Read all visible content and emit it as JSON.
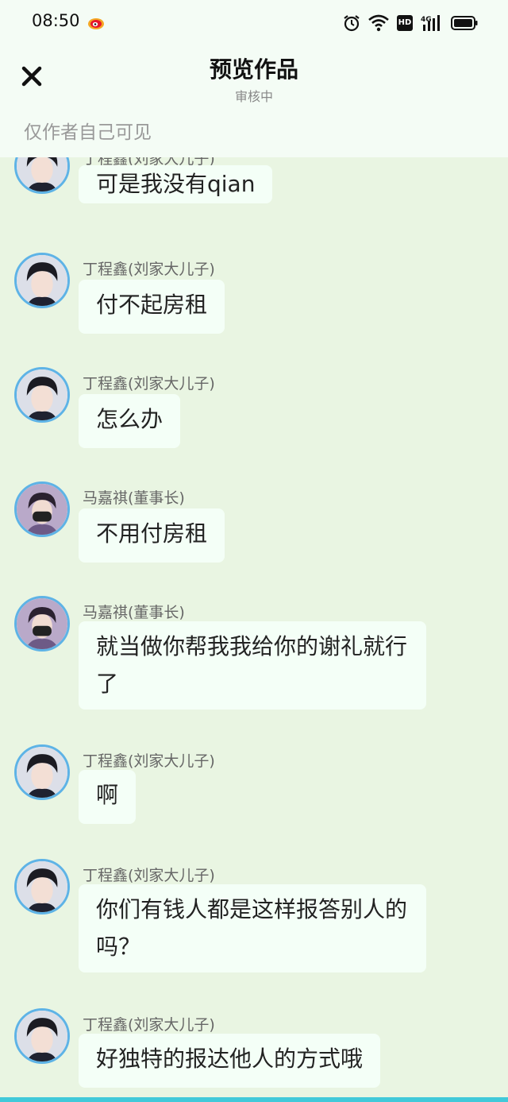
{
  "status_bar": {
    "time": "08:50",
    "network": "4G"
  },
  "header": {
    "title": "预览作品",
    "subtitle": "审核中",
    "notice": "仅作者自己可见"
  },
  "messages": [
    {
      "sender": "丁程鑫(刘家大儿子)",
      "text": "可是我没有qian"
    },
    {
      "sender": "丁程鑫(刘家大儿子)",
      "text": "付不起房租"
    },
    {
      "sender": "丁程鑫(刘家大儿子)",
      "text": "怎么办"
    },
    {
      "sender": "马嘉祺(董事长)",
      "text": "不用付房租"
    },
    {
      "sender": "马嘉祺(董事长)",
      "text": "就当做你帮我我给你的谢礼就行了"
    },
    {
      "sender": "丁程鑫(刘家大儿子)",
      "text": "啊"
    },
    {
      "sender": "丁程鑫(刘家大儿子)",
      "text": "你们有钱人都是这样报答别人的吗？"
    },
    {
      "sender": "丁程鑫(刘家大儿子)",
      "text": "好独特的报达他人的方式哦"
    }
  ],
  "colors": {
    "accent_ring": "#5eb3e6",
    "background": "#e9f5e2",
    "bubble": "#f4fff7"
  }
}
